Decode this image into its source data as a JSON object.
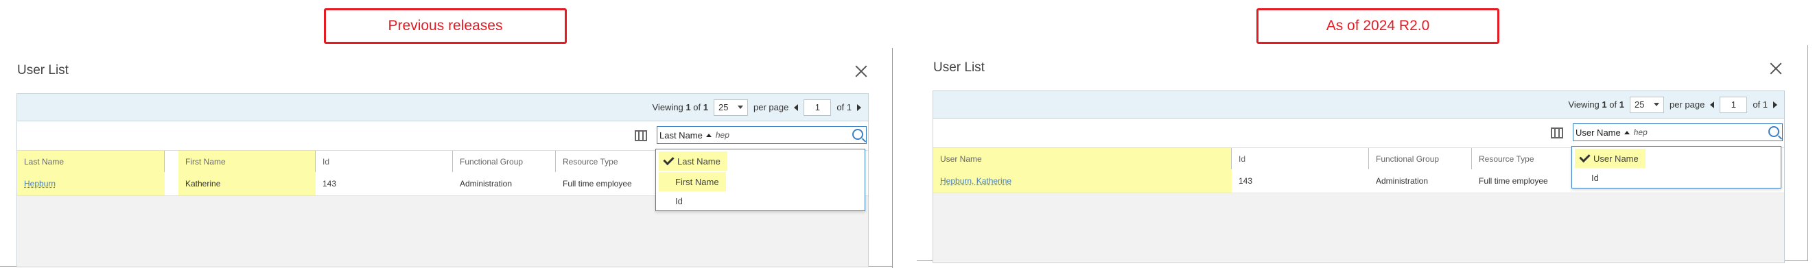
{
  "callouts": {
    "left": "Previous releases",
    "right": "As of 2024 R2.0"
  },
  "colors": {
    "callout_border": "#e31b23",
    "highlight": "#fdfca8",
    "accent": "#3b7fc4",
    "link": "#4a7db3"
  },
  "left": {
    "title": "User List",
    "pager": {
      "viewing": "Viewing",
      "from": "1",
      "of_word": "of",
      "total": "1",
      "per_page_value": "25",
      "per_page_label": "per page",
      "page": "1",
      "of_pages": "of 1"
    },
    "search": {
      "field": "Last Name",
      "query": "hep"
    },
    "columns": [
      "Last Name",
      "First Name",
      "Id",
      "Functional Group",
      "Resource Type"
    ],
    "row": [
      "Hepburn",
      "Katherine",
      "143",
      "Administration",
      "Full time employee"
    ],
    "dropdown": [
      "Last Name",
      "First Name",
      "Id"
    ]
  },
  "right": {
    "title": "User List",
    "pager": {
      "viewing": "Viewing",
      "from": "1",
      "of_word": "of",
      "total": "1",
      "per_page_value": "25",
      "per_page_label": "per page",
      "page": "1",
      "of_pages": "of 1"
    },
    "search": {
      "field": "User Name",
      "query": "hep"
    },
    "columns": [
      "User Name",
      "Id",
      "Functional Group",
      "Resource Type"
    ],
    "row": [
      "Hepburn, Katherine",
      "143",
      "Administration",
      "Full time employee"
    ],
    "dropdown": [
      "User Name",
      "Id"
    ]
  },
  "icons": [
    "close-icon",
    "columns-icon",
    "search-icon",
    "sort-ascending-icon",
    "check-icon",
    "chevron-down-icon",
    "prev-page-icon",
    "next-page-icon"
  ]
}
